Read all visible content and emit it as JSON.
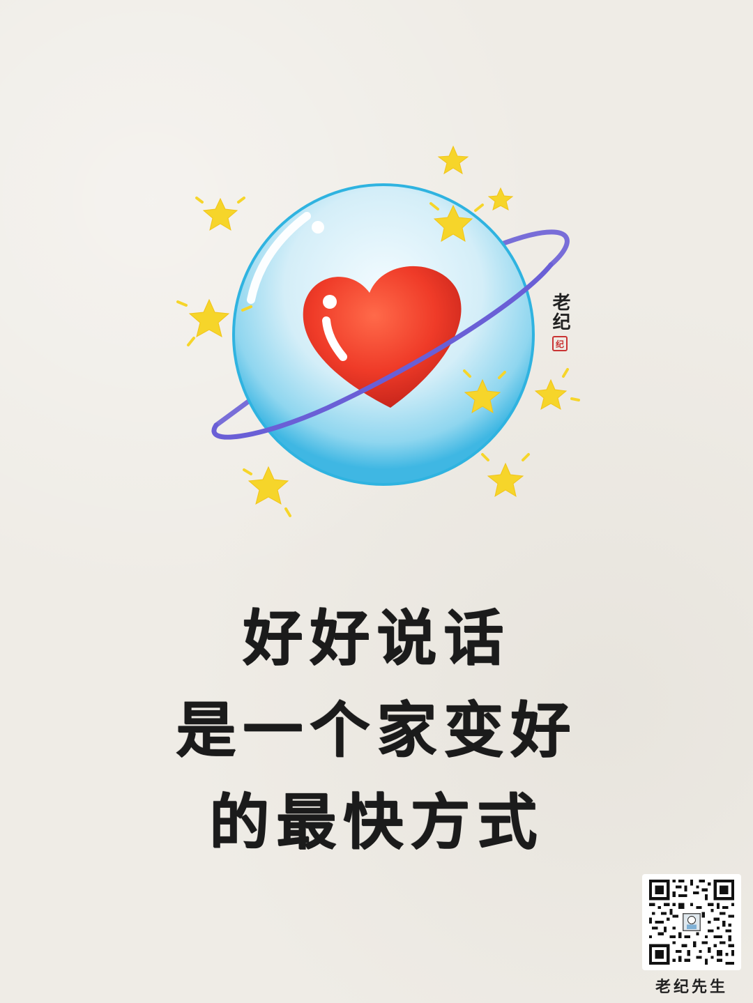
{
  "signature": {
    "name": "老纪",
    "seal_text": "纪"
  },
  "quote": {
    "lines": [
      "好好说话",
      "是一个家变好",
      "的最快方式"
    ]
  },
  "qr": {
    "caption": "老纪先生"
  },
  "colors": {
    "background": "#efece6",
    "globe": "#5cc4e8",
    "ring": "#6a5fd6",
    "heart": "#e8392a",
    "star": "#f6d52a",
    "text": "#1b1b1b"
  }
}
